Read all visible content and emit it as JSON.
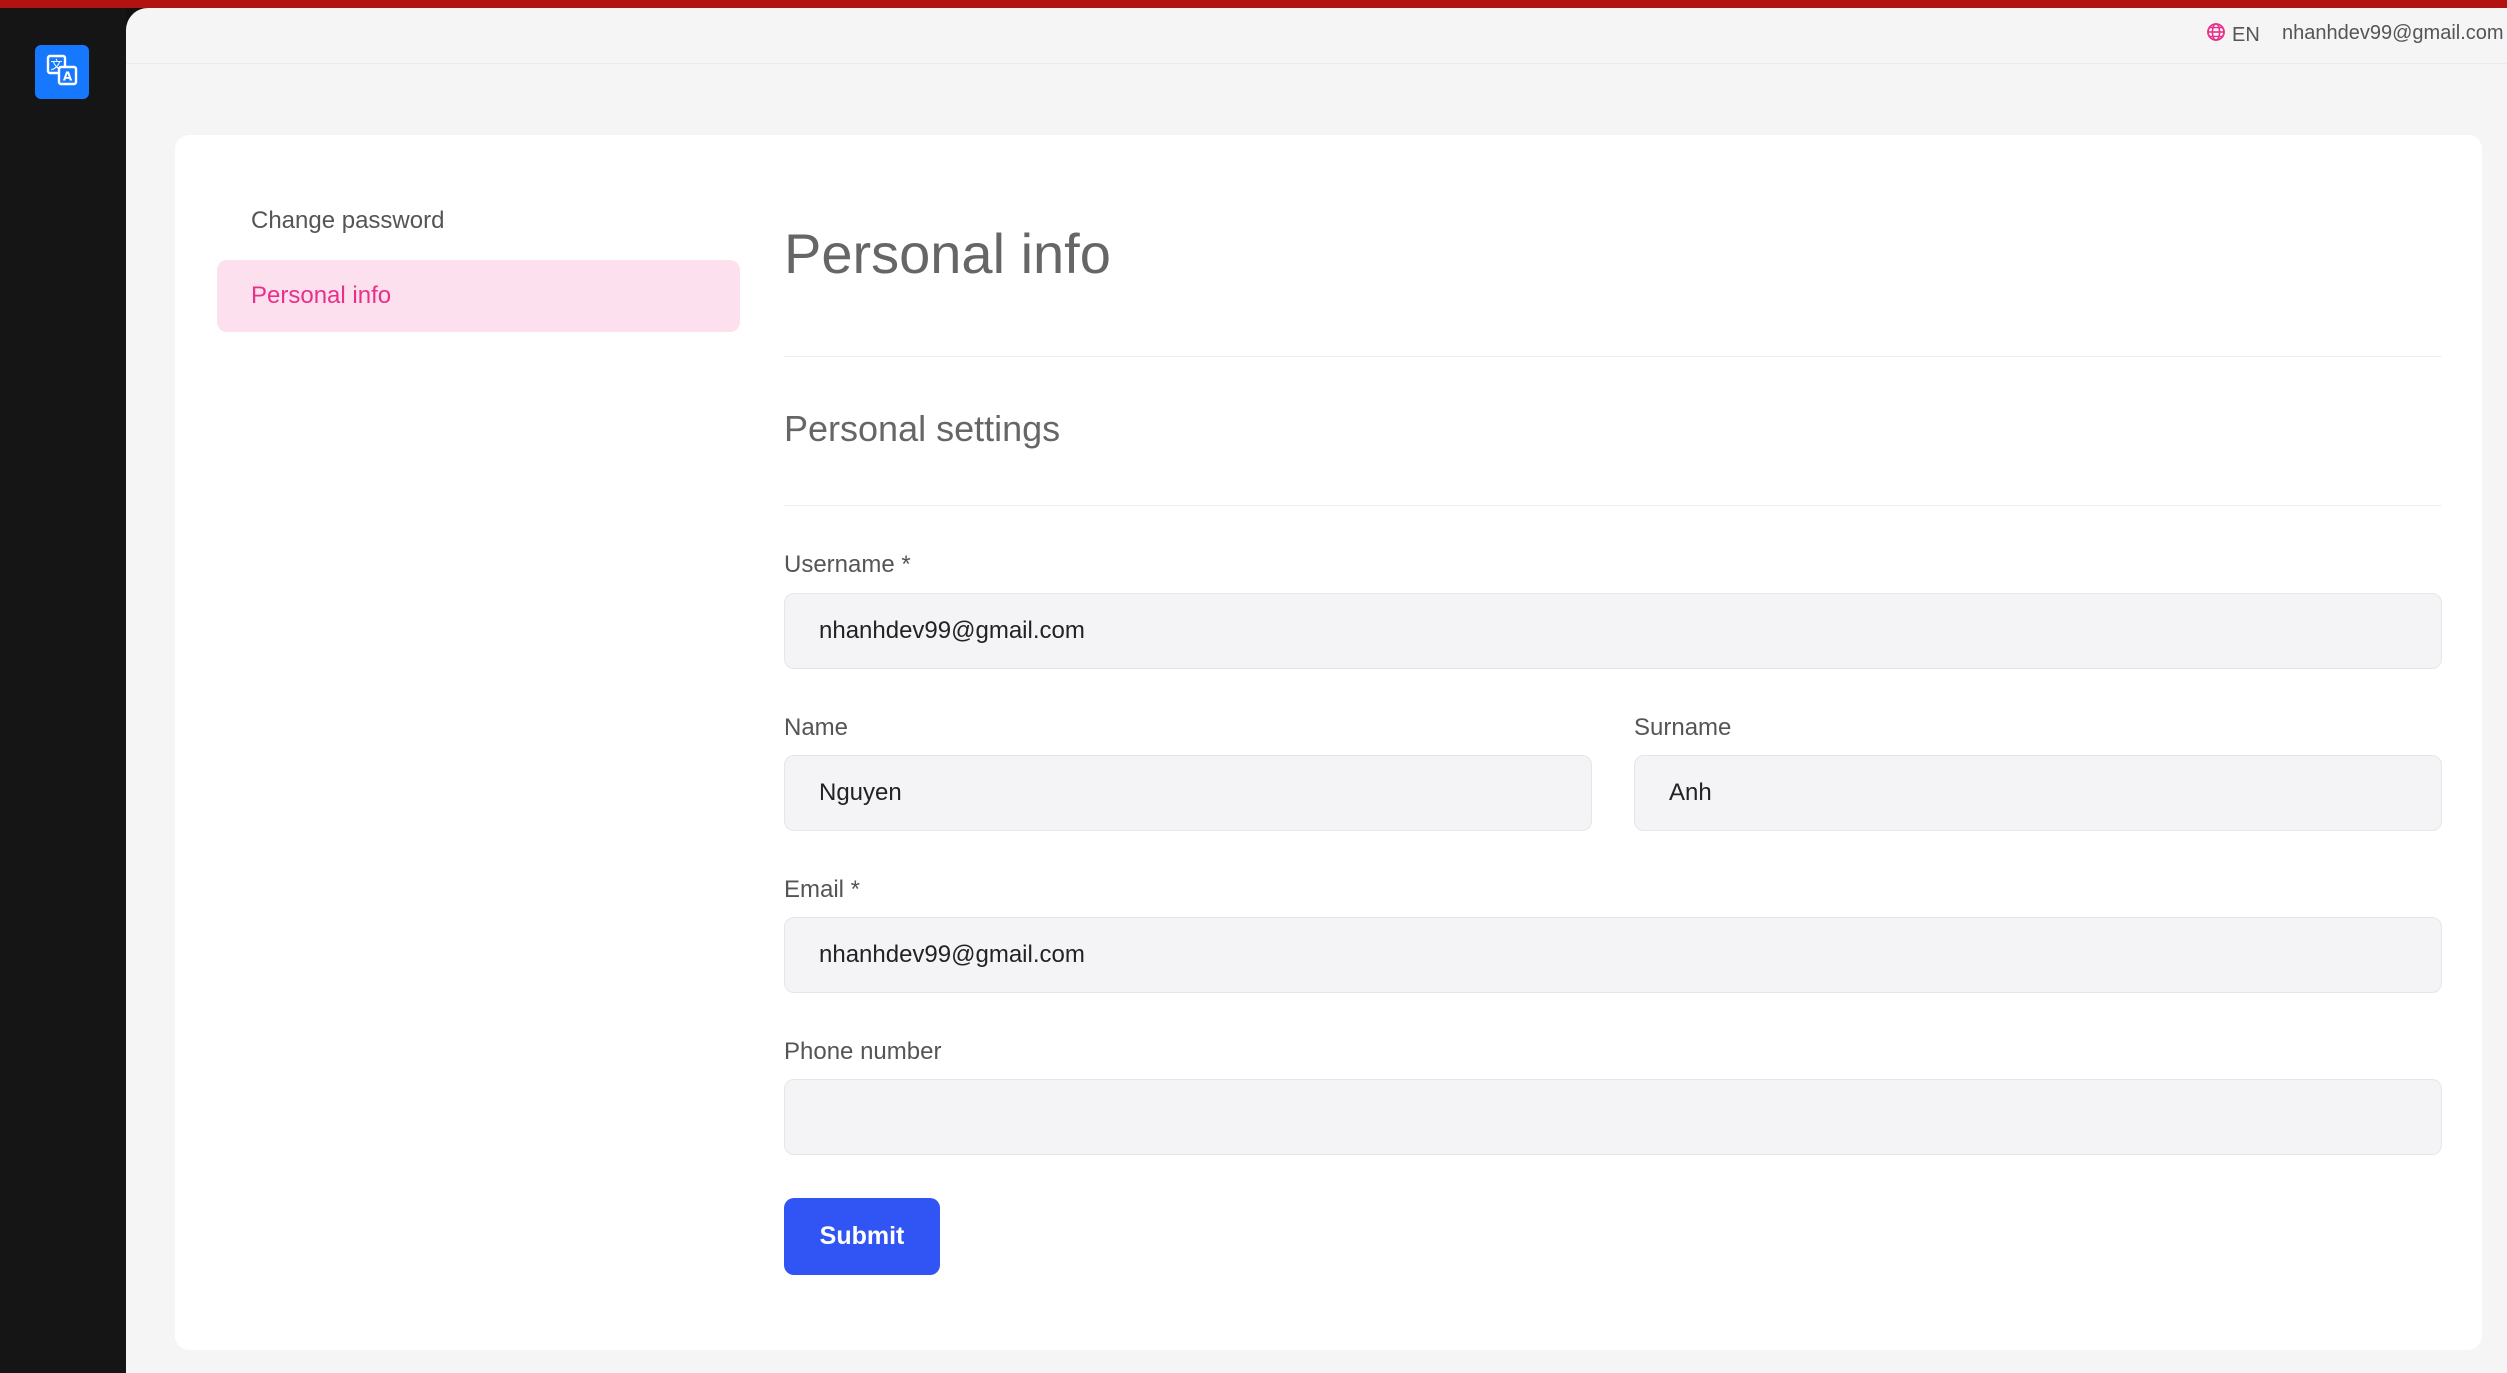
{
  "header": {
    "language": "EN",
    "user_email": "nhanhdev99@gmail.com"
  },
  "nav": {
    "items": [
      {
        "label": "Change password",
        "active": false
      },
      {
        "label": "Personal info",
        "active": true
      }
    ]
  },
  "page": {
    "title": "Personal info",
    "section_title": "Personal settings"
  },
  "form": {
    "username": {
      "label": "Username *",
      "value": "nhanhdev99@gmail.com"
    },
    "name": {
      "label": "Name",
      "value": "Nguyen"
    },
    "surname": {
      "label": "Surname",
      "value": "Anh"
    },
    "email": {
      "label": "Email *",
      "value": "nhanhdev99@gmail.com"
    },
    "phone": {
      "label": "Phone number",
      "value": ""
    },
    "submit_label": "Submit"
  },
  "colors": {
    "accent_pink": "#e8308a",
    "primary_button": "#3154f5",
    "logo_blue": "#1677ff",
    "top_accent": "#b31212"
  },
  "icons": {
    "logo": "translate-icon",
    "language": "globe-icon"
  }
}
